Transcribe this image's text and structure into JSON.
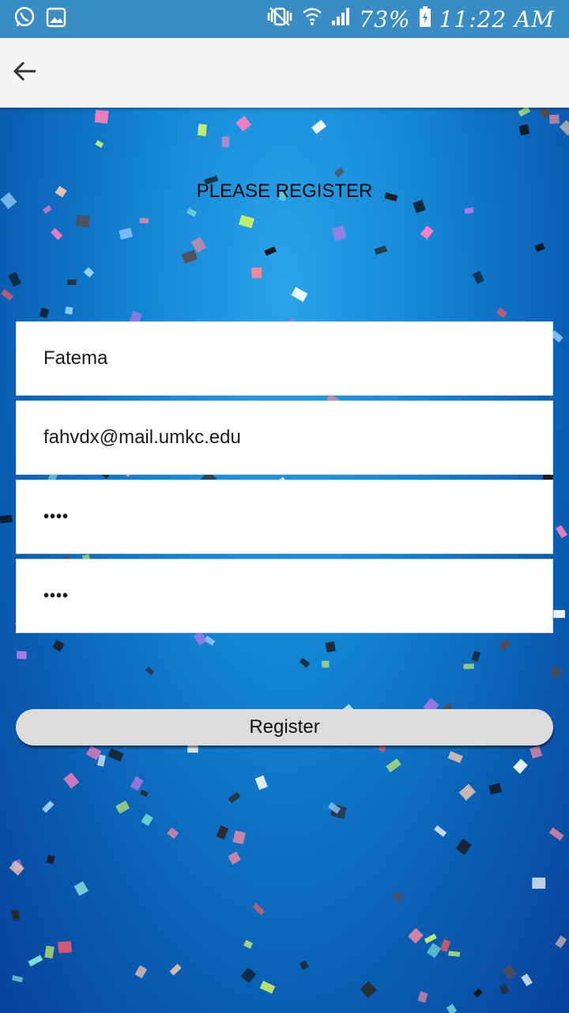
{
  "status_bar": {
    "battery_percent": "73%",
    "time": "11:22 AM",
    "icons": [
      "whatsapp-icon",
      "gallery-icon",
      "mute-vibrate-icon",
      "wifi-icon",
      "signal-icon",
      "battery-charging-icon"
    ]
  },
  "app_bar": {
    "back_icon": "arrow-back-icon"
  },
  "page": {
    "title": "PLEASE REGISTER"
  },
  "form": {
    "name_value": "Fatema",
    "email_value": "fahvdx@mail.umkc.edu",
    "password_value": "••••",
    "confirm_password_value": "••••",
    "register_label": "Register"
  },
  "colors": {
    "status_bar": "#3a8cc4",
    "app_bar": "#f5f5f5",
    "background_top": "#2aa3e8",
    "background_bottom": "#08419a",
    "button": "#dcdcdc"
  }
}
